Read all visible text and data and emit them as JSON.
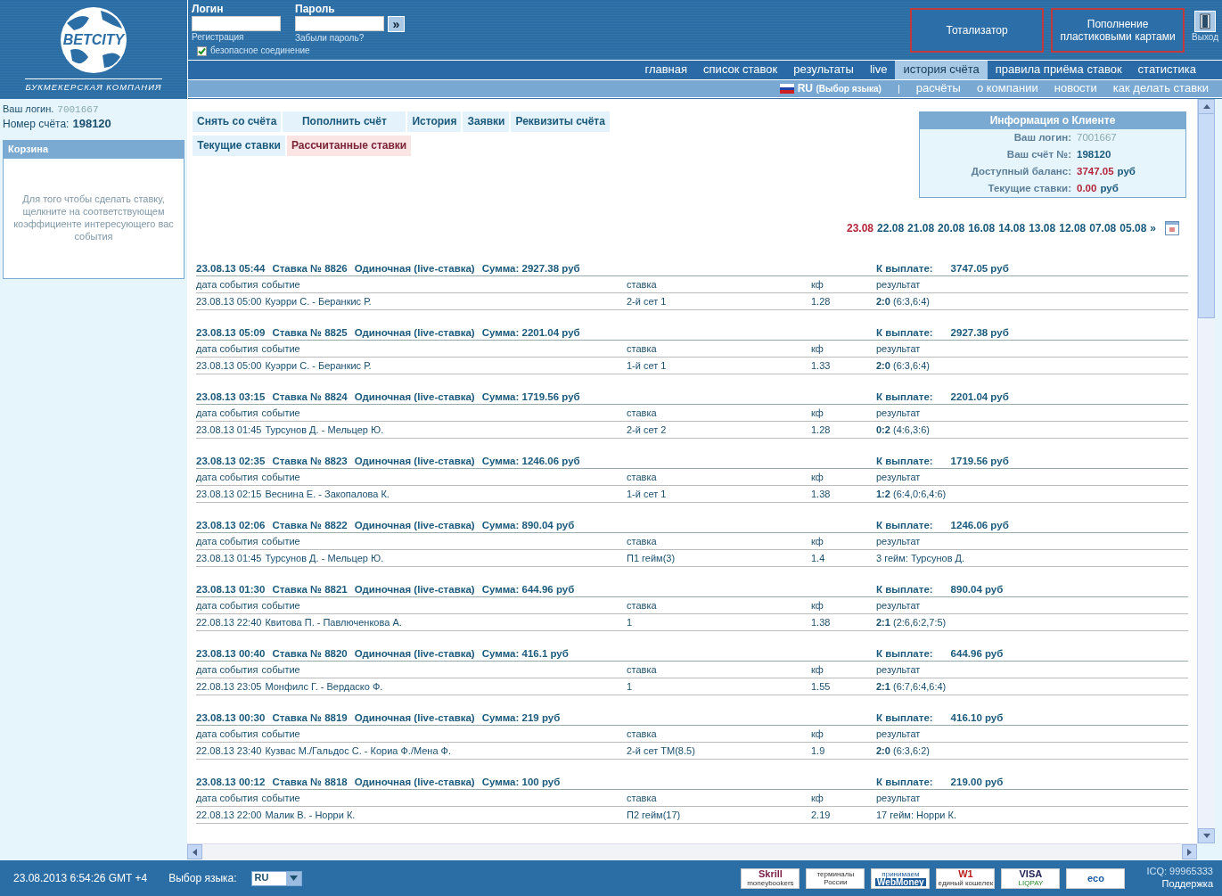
{
  "logo": {
    "name": "BETCITY",
    "tagline": "БУКМЕКЕРСКАЯ КОМПАНИЯ"
  },
  "login_form": {
    "login_label": "Логин",
    "password_label": "Пароль",
    "submit": "»",
    "register_link": "Регистрация",
    "forgot_link": "Забыли пароль?",
    "secure": {
      "label": "безопасное соединение",
      "checked": true
    }
  },
  "header_buttons": [
    "Тотализатор",
    "Пополнение пластиковыми картами"
  ],
  "exit": {
    "label": "Выход"
  },
  "main_nav": [
    {
      "label": "главная",
      "selected": false
    },
    {
      "label": "список ставок",
      "selected": false
    },
    {
      "label": "результаты",
      "selected": false
    },
    {
      "label": "live",
      "selected": false
    },
    {
      "label": "история счёта",
      "selected": true
    },
    {
      "label": "правила приёма ставок",
      "selected": false
    },
    {
      "label": "статистика",
      "selected": false
    }
  ],
  "sub_nav": {
    "language": "RU",
    "language_hint": "(Выбор языка)",
    "separator": "|",
    "links": [
      "расчёты",
      "о компании",
      "новости",
      "как делать ставки"
    ]
  },
  "sidebar": {
    "login_label": "Ваш логин.",
    "login_value": "7001667",
    "account_label": "Номер счёта:",
    "account_value": "198120",
    "basket": {
      "title": "Корзина",
      "text": "Для того чтобы сделать ставку, щелкните на соответствующем коэффициенте интересующего вас события"
    }
  },
  "account_tabs": [
    [
      {
        "label": "Снять со счёта",
        "selected": false
      },
      {
        "label": "Пополнить счёт",
        "selected": false
      },
      {
        "label": "История",
        "selected": false
      },
      {
        "label": "Заявки",
        "selected": false
      },
      {
        "label": "Реквизиты счёта",
        "selected": false
      }
    ],
    [
      {
        "label": "Текущие ставки",
        "selected": false
      },
      {
        "label": "Рассчитанные ставки",
        "selected": true
      }
    ]
  ],
  "client_info": {
    "title": "Информация о Клиенте",
    "rows": [
      {
        "label": "Ваш логин:",
        "value": "7001667",
        "unit": "",
        "kind": "plain"
      },
      {
        "label": "Ваш счёт №:",
        "value": "198120",
        "unit": "",
        "kind": "plain"
      },
      {
        "label": "Доступный баланс:",
        "value": "3747.05",
        "unit": "руб",
        "kind": "money"
      },
      {
        "label": "Текущие ставки:",
        "value": "0.00",
        "unit": "руб",
        "kind": "money"
      }
    ]
  },
  "dates": [
    {
      "label": "23.08",
      "selected": true
    },
    {
      "label": "22.08",
      "selected": false
    },
    {
      "label": "21.08",
      "selected": false
    },
    {
      "label": "20.08",
      "selected": false
    },
    {
      "label": "16.08",
      "selected": false
    },
    {
      "label": "14.08",
      "selected": false
    },
    {
      "label": "13.08",
      "selected": false
    },
    {
      "label": "12.08",
      "selected": false
    },
    {
      "label": "07.08",
      "selected": false
    },
    {
      "label": "05.08",
      "selected": false
    }
  ],
  "dates_more": "»",
  "bets": [
    {
      "time": "23.08.13 05:44",
      "number": "Ставка № 8826",
      "type": "Одиночная (live-ставка)",
      "sum": "Сумма: 2927.38 руб",
      "payout_label": "К выплате:",
      "payout": "3747.05 руб",
      "columns": [
        "дата события",
        "событие",
        "ставка",
        "кф",
        "результат"
      ],
      "event_date": "23.08.13 05:00",
      "event": "Куэрри С. - Беранкис Р.",
      "bet": "2-й сет 1",
      "odds": "1.28",
      "result": "**2:0** (6:3,6:4)"
    },
    {
      "time": "23.08.13 05:09",
      "number": "Ставка № 8825",
      "type": "Одиночная (live-ставка)",
      "sum": "Сумма: 2201.04 руб",
      "payout_label": "К выплате:",
      "payout": "2927.38 руб",
      "columns": [
        "дата события",
        "событие",
        "ставка",
        "кф",
        "результат"
      ],
      "event_date": "23.08.13 05:00",
      "event": "Куэрри С. - Беранкис Р.",
      "bet": "1-й сет 1",
      "odds": "1.33",
      "result": "**2:0** (6:3,6:4)"
    },
    {
      "time": "23.08.13 03:15",
      "number": "Ставка № 8824",
      "type": "Одиночная (live-ставка)",
      "sum": "Сумма: 1719.56 руб",
      "payout_label": "К выплате:",
      "payout": "2201.04 руб",
      "columns": [
        "дата события",
        "событие",
        "ставка",
        "кф",
        "результат"
      ],
      "event_date": "23.08.13 01:45",
      "event": "Турсунов Д. - Мельцер Ю.",
      "bet": "2-й сет 2",
      "odds": "1.28",
      "result": "**0:2** (4:6,3:6)"
    },
    {
      "time": "23.08.13 02:35",
      "number": "Ставка № 8823",
      "type": "Одиночная (live-ставка)",
      "sum": "Сумма: 1246.06 руб",
      "payout_label": "К выплате:",
      "payout": "1719.56 руб",
      "columns": [
        "дата события",
        "событие",
        "ставка",
        "кф",
        "результат"
      ],
      "event_date": "23.08.13 02:15",
      "event": "Веснина Е. - Закопалова К.",
      "bet": "1-й сет 1",
      "odds": "1.38",
      "result": "**1:2** (6:4,0:6,4:6)"
    },
    {
      "time": "23.08.13 02:06",
      "number": "Ставка № 8822",
      "type": "Одиночная (live-ставка)",
      "sum": "Сумма: 890.04 руб",
      "payout_label": "К выплате:",
      "payout": "1246.06 руб",
      "columns": [
        "дата события",
        "событие",
        "ставка",
        "кф",
        "результат"
      ],
      "event_date": "23.08.13 01:45",
      "event": "Турсунов Д. - Мельцер Ю.",
      "bet": "П1 гейм(3)",
      "odds": "1.4",
      "result": "3 гейм: Турсунов Д."
    },
    {
      "time": "23.08.13 01:30",
      "number": "Ставка № 8821",
      "type": "Одиночная (live-ставка)",
      "sum": "Сумма: 644.96 руб",
      "payout_label": "К выплате:",
      "payout": "890.04 руб",
      "columns": [
        "дата события",
        "событие",
        "ставка",
        "кф",
        "результат"
      ],
      "event_date": "22.08.13 22:40",
      "event": "Квитова П. - Павлюченкова А.",
      "bet": "1",
      "odds": "1.38",
      "result": "**2:1** (2:6,6:2,7:5)"
    },
    {
      "time": "23.08.13 00:40",
      "number": "Ставка № 8820",
      "type": "Одиночная (live-ставка)",
      "sum": "Сумма: 416.1 руб",
      "payout_label": "К выплате:",
      "payout": "644.96 руб",
      "columns": [
        "дата события",
        "событие",
        "ставка",
        "кф",
        "результат"
      ],
      "event_date": "22.08.13 23:05",
      "event": "Монфилс Г. - Вердаско Ф.",
      "bet": "1",
      "odds": "1.55",
      "result": "**2:1** (6:7,6:4,6:4)"
    },
    {
      "time": "23.08.13 00:30",
      "number": "Ставка № 8819",
      "type": "Одиночная (live-ставка)",
      "sum": "Сумма: 219 руб",
      "payout_label": "К выплате:",
      "payout": "416.10 руб",
      "columns": [
        "дата события",
        "событие",
        "ставка",
        "кф",
        "результат"
      ],
      "event_date": "22.08.13 23:40",
      "event": "Кузвас М./Гальдос С. - Кориа Ф./Мена Ф.",
      "bet": "2-й сет ТМ(8.5)",
      "odds": "1.9",
      "result": "**2:0** (6:3,6:2)"
    },
    {
      "time": "23.08.13 00:12",
      "number": "Ставка № 8818",
      "type": "Одиночная (live-ставка)",
      "sum": "Сумма: 100 руб",
      "payout_label": "К выплате:",
      "payout": "219.00 руб",
      "columns": [
        "дата события",
        "событие",
        "ставка",
        "кф",
        "результат"
      ],
      "event_date": "22.08.13 22:00",
      "event": "Малик В. - Норри К.",
      "bet": "П2 гейм(17)",
      "odds": "2.19",
      "result": "17 гейм: Норри К."
    }
  ],
  "footer": {
    "datetime": "23.08.2013 6:54:26 GMT +4",
    "language_label": "Выбор языка:",
    "language_value": "RU",
    "payments": [
      {
        "kind": "skrill",
        "lines": [
          "Skrill",
          "moneybookers"
        ]
      },
      {
        "kind": "terminals",
        "lines": [
          "терминалы",
          "России"
        ]
      },
      {
        "kind": "webmoney",
        "lines": [
          "принимаем",
          "WebMoney"
        ]
      },
      {
        "kind": "w1",
        "lines": [
          "W1",
          "единый кошелек"
        ]
      },
      {
        "kind": "liqpay",
        "lines": [
          "VISA",
          "LIQPAY"
        ]
      },
      {
        "kind": "eco",
        "lines": [
          "eco"
        ]
      }
    ],
    "icq": "ICQ: 99965333",
    "support": "Поддержка"
  }
}
